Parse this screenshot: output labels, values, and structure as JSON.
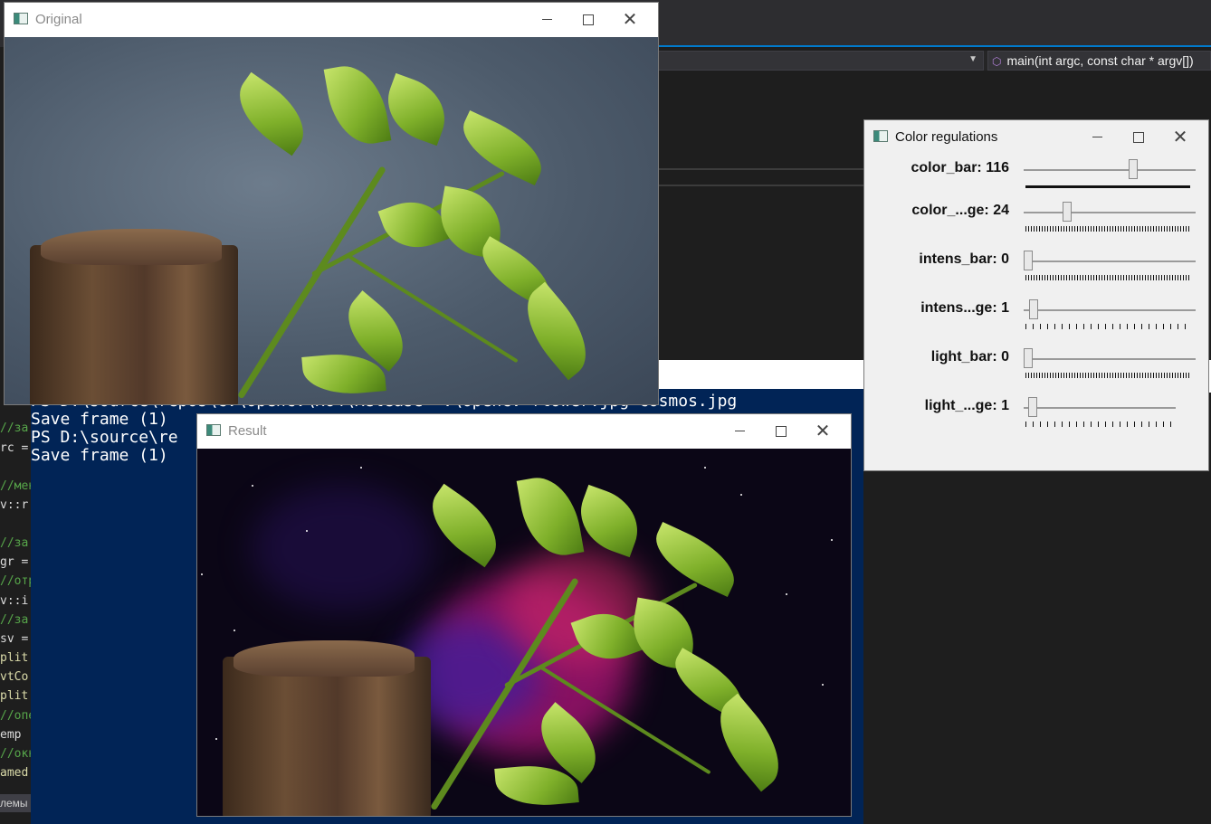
{
  "ide": {
    "function_selector": "main(int argc, const char * argv[])",
    "code_lines": [
      {
        "text": "//за",
        "cls": "c-green"
      },
      {
        "text": "rc =",
        "cls": "c-white"
      },
      {
        "text": "//мен",
        "cls": "c-green"
      },
      {
        "text": "v::r",
        "cls": "c-white"
      },
      {
        "text": "//за",
        "cls": "c-green"
      },
      {
        "text": "gr =",
        "cls": "c-white"
      },
      {
        "text": "//отр",
        "cls": "c-green"
      },
      {
        "text": "v::i",
        "cls": "c-white"
      },
      {
        "text": "//за",
        "cls": "c-green"
      },
      {
        "text": "sv =",
        "cls": "c-white"
      },
      {
        "text": "plit",
        "cls": "c-yellow"
      },
      {
        "text": "vtCo",
        "cls": "c-yellow"
      },
      {
        "text": "plit",
        "cls": "c-yellow"
      },
      {
        "text": "//опе",
        "cls": "c-green"
      },
      {
        "text": "emp",
        "cls": "c-white"
      },
      {
        "text": "//окн",
        "cls": "c-green"
      },
      {
        "text": "amed",
        "cls": "c-yellow"
      }
    ],
    "status_text": "лемы"
  },
  "terminal": {
    "lines": [
      "PS D:\\source\\repos\\CV\\OpenCV\\x64\\Release> .\\OpenCV flower.jpg cosmos.jpg",
      "Save frame (1)",
      "PS D:\\source\\re",
      "Save frame (1)"
    ]
  },
  "windows": {
    "original": {
      "title": "Original"
    },
    "result": {
      "title": "Result"
    },
    "color_regulations": {
      "title": "Color regulations",
      "controls": [
        {
          "label": "color_bar: 116",
          "value": 116,
          "max": 180,
          "ticks": "solid"
        },
        {
          "label": "color_...ge: 24",
          "value": 24,
          "max": 100,
          "ticks": "dense"
        },
        {
          "label": "intens_bar: 0",
          "value": 0,
          "max": 255,
          "ticks": "dense"
        },
        {
          "label": "intens...ge: 1",
          "value": 1,
          "max": 30,
          "ticks": "sparse"
        },
        {
          "label": "light_bar: 0",
          "value": 0,
          "max": 255,
          "ticks": "dense"
        },
        {
          "label": "light_...ge: 1",
          "value": 1,
          "max": 30,
          "ticks": "sparse"
        }
      ]
    }
  }
}
